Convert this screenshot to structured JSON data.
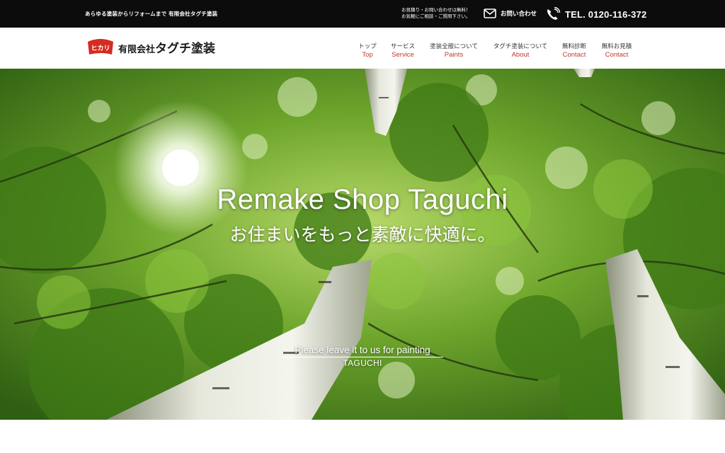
{
  "topbar": {
    "tagline": "あらゆる塗装からリフォームまで 有限会社タグチ塗装",
    "note_line1": "お見積り・お問い合わせは無料！",
    "note_line2": "お気軽にご相談・ご質問下さい。",
    "contact_label": "お問い合わせ",
    "contact_icon": "mail-icon",
    "tel_label": "TEL. 0120-116-372",
    "tel_icon": "phone-icon"
  },
  "header": {
    "logo_mark": "ヒカリ",
    "company_prefix": "有限会社",
    "company_name": "タグチ塗装"
  },
  "nav": [
    {
      "jp": "トップ",
      "en": "Top"
    },
    {
      "jp": "サービス",
      "en": "Service"
    },
    {
      "jp": "塗装全般について",
      "en": "Paints"
    },
    {
      "jp": "タグチ塗装について",
      "en": "About"
    },
    {
      "jp": "無料診断",
      "en": "Contact"
    },
    {
      "jp": "無料お見積",
      "en": "Contact"
    }
  ],
  "hero": {
    "title": "Remake Shop Taguchi",
    "subtitle": "お住まいをもっと素敵に快適に。",
    "leave": "Please leave it to us for painting",
    "brand": "TAGUCHI"
  },
  "colors": {
    "topbar_bg": "#0c0c0c",
    "nav_en": "#c0392b",
    "logo_red": "#d62b1f",
    "foliage": "#4e8a1e"
  }
}
